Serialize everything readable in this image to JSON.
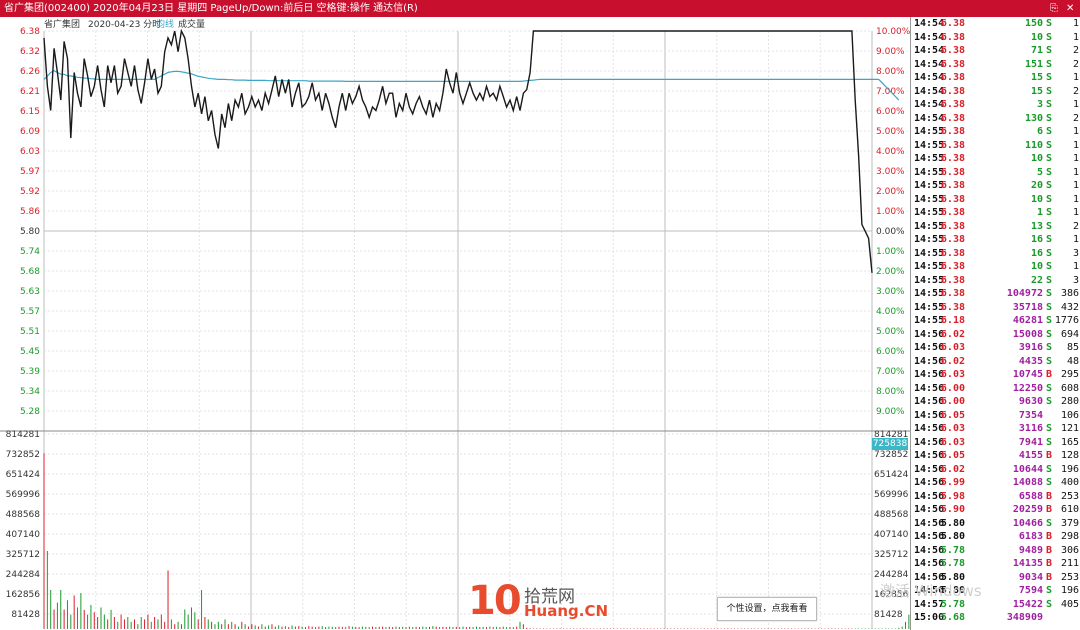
{
  "window": {
    "title": "省广集团(002400)  2020年04月23日  星期四  PageUp/Down:前后日  空格键:操作  通达信(R)",
    "controls": [
      "⎘",
      "✕"
    ]
  },
  "chart_header": {
    "name": "省广集团",
    "date": "2020-04-23 分时",
    "avg_label": "均线",
    "vol_label": "成交量"
  },
  "colors": {
    "up": "#d8202a",
    "down": "#1a9a2a",
    "price_line": "#1a1a1a",
    "avg_line": "#3ba6c9",
    "grid": "#e3e3e3",
    "grid_major": "#bcbcbc",
    "purple": "#a020a0",
    "titlebar": "#c8102e"
  },
  "price_axis": {
    "left_ticks": [
      "6.38",
      "6.32",
      "6.26",
      "6.21",
      "6.15",
      "6.09",
      "6.03",
      "5.97",
      "5.92",
      "5.86",
      "5.80",
      "5.74",
      "5.68",
      "5.63",
      "5.57",
      "5.51",
      "5.45",
      "5.39",
      "5.34",
      "5.28"
    ],
    "right_ticks": [
      "10.00%",
      "9.00%",
      "8.00%",
      "7.00%",
      "6.00%",
      "5.00%",
      "4.00%",
      "3.00%",
      "2.00%",
      "1.00%",
      "0.00%",
      "1.00%",
      "2.00%",
      "3.00%",
      "4.00%",
      "5.00%",
      "6.00%",
      "7.00%",
      "8.00%",
      "9.00%"
    ],
    "prev_close": 5.8,
    "high": 6.38,
    "low": 5.28
  },
  "volume_axis": {
    "ticks": [
      "814281",
      "732852",
      "651424",
      "569996",
      "488568",
      "407140",
      "325712",
      "244284",
      "162856",
      "81428"
    ],
    "max": 814281,
    "current_label": "725838"
  },
  "chart_data": {
    "type": "line",
    "title": "省广集团 2020-04-23 分时",
    "xlabel": "",
    "ylabel": "",
    "ylim": [
      5.28,
      6.38
    ],
    "series": [
      {
        "name": "分时",
        "x_note": "",
        "values": [
          6.36,
          6.22,
          6.15,
          6.33,
          6.26,
          6.18,
          6.35,
          6.3,
          6.07,
          6.26,
          6.2,
          6.16,
          6.3,
          6.25,
          6.19,
          6.22,
          6.28,
          6.21,
          6.16,
          6.28,
          6.23,
          6.28,
          6.2,
          6.22,
          6.3,
          6.26,
          6.22,
          6.28,
          6.21,
          6.17,
          6.23,
          6.3,
          6.24,
          6.27,
          6.2,
          6.22,
          6.32,
          6.36,
          6.34,
          6.38,
          6.32,
          6.38,
          6.36,
          6.3,
          6.22,
          6.16,
          6.2,
          6.14,
          6.19,
          6.12,
          6.15,
          6.08,
          6.04,
          6.14,
          6.1,
          6.17,
          6.12,
          6.18,
          6.16,
          6.2,
          6.14,
          6.16,
          6.19,
          6.16,
          6.18,
          6.15,
          6.2,
          6.17,
          6.21,
          6.25,
          6.19,
          6.24,
          6.2,
          6.24,
          6.16,
          6.2,
          6.23,
          6.16,
          6.17,
          6.19,
          6.23,
          6.18,
          6.2,
          6.15,
          6.2,
          6.17,
          6.13,
          6.1,
          6.16,
          6.2,
          6.15,
          6.2,
          6.17,
          6.19,
          6.22,
          6.18,
          6.16,
          6.13,
          6.16,
          6.15,
          6.18,
          6.22,
          6.17,
          6.2,
          6.2,
          6.13,
          6.17,
          6.15,
          6.2,
          6.16,
          6.14,
          6.17,
          6.19,
          6.16,
          6.14,
          6.18,
          6.13,
          6.17,
          6.15,
          6.2,
          6.27,
          6.23,
          6.2,
          6.26,
          6.2,
          6.17,
          6.2,
          6.23,
          6.2,
          6.18,
          6.2,
          6.18,
          6.22,
          6.19,
          6.2,
          6.18,
          6.22,
          6.19,
          6.16,
          6.18,
          6.15,
          6.19,
          6.15,
          6.2,
          6.21,
          6.26,
          6.38,
          6.38,
          6.38,
          6.38,
          6.38,
          6.38,
          6.38,
          6.38,
          6.38,
          6.38,
          6.38,
          6.38,
          6.38,
          6.38,
          6.38,
          6.38,
          6.38,
          6.38,
          6.38,
          6.38,
          6.38,
          6.38,
          6.38,
          6.38,
          6.38,
          6.38,
          6.38,
          6.38,
          6.38,
          6.38,
          6.38,
          6.38,
          6.38,
          6.38,
          6.38,
          6.38,
          6.38,
          6.38,
          6.38,
          6.38,
          6.38,
          6.38,
          6.38,
          6.38,
          6.38,
          6.38,
          6.38,
          6.38,
          6.38,
          6.38,
          6.38,
          6.38,
          6.38,
          6.38,
          6.38,
          6.38,
          6.38,
          6.38,
          6.38,
          6.38,
          6.38,
          6.38,
          6.38,
          6.38,
          6.38,
          6.38,
          6.38,
          6.38,
          6.38,
          6.38,
          6.38,
          6.38,
          6.38,
          6.38,
          6.38,
          6.38,
          6.38,
          6.38,
          6.38,
          6.38,
          6.38,
          6.38,
          6.38,
          6.38,
          6.38,
          6.38,
          6.38,
          6.38,
          6.38,
          6.38,
          6.38,
          6.38,
          6.38,
          6.38,
          6.38,
          6.38,
          6.18,
          6.02,
          5.82,
          5.8,
          5.78,
          5.68
        ]
      },
      {
        "name": "均线",
        "values": [
          6.24,
          6.25,
          6.26,
          6.265,
          6.26,
          6.255,
          6.255,
          6.25,
          6.25,
          6.248,
          6.246,
          6.245,
          6.244,
          6.243,
          6.242,
          6.241,
          6.24,
          6.24,
          6.24,
          6.24,
          6.24,
          6.24,
          6.24,
          6.24,
          6.24,
          6.24,
          6.24,
          6.24,
          6.24,
          6.24,
          6.24,
          6.24,
          6.24,
          6.24,
          6.245,
          6.25,
          6.255,
          6.26,
          6.262,
          6.263,
          6.263,
          6.262,
          6.26,
          6.258,
          6.256,
          6.252,
          6.249,
          6.247,
          6.245,
          6.243,
          6.242,
          6.241,
          6.24,
          6.24,
          6.24,
          6.239,
          6.239,
          6.238,
          6.238,
          6.238,
          6.238,
          6.237,
          6.237,
          6.237,
          6.237,
          6.237,
          6.237,
          6.236,
          6.236,
          6.236,
          6.236,
          6.236,
          6.236,
          6.236,
          6.236,
          6.236,
          6.236,
          6.236,
          6.236,
          6.235,
          6.235,
          6.235,
          6.235,
          6.235,
          6.235,
          6.235,
          6.235,
          6.235,
          6.235,
          6.235,
          6.234,
          6.234,
          6.234,
          6.234,
          6.234,
          6.234,
          6.234,
          6.234,
          6.234,
          6.234,
          6.234,
          6.234,
          6.234,
          6.234,
          6.234,
          6.234,
          6.234,
          6.234,
          6.234,
          6.234,
          6.234,
          6.234,
          6.234,
          6.234,
          6.234,
          6.234,
          6.234,
          6.234,
          6.234,
          6.234,
          6.234,
          6.234,
          6.234,
          6.234,
          6.234,
          6.234,
          6.234,
          6.234,
          6.234,
          6.234,
          6.234,
          6.234,
          6.234,
          6.234,
          6.234,
          6.234,
          6.234,
          6.234,
          6.234,
          6.234,
          6.234,
          6.234,
          6.234,
          6.235,
          6.236,
          6.237,
          6.238,
          6.239,
          6.24,
          6.24,
          6.24,
          6.24,
          6.24,
          6.24,
          6.24,
          6.24,
          6.24,
          6.24,
          6.24,
          6.24,
          6.24,
          6.24,
          6.24,
          6.24,
          6.24,
          6.24,
          6.24,
          6.24,
          6.24,
          6.24,
          6.24,
          6.24,
          6.24,
          6.24,
          6.24,
          6.24,
          6.24,
          6.24,
          6.24,
          6.24,
          6.24,
          6.24,
          6.24,
          6.24,
          6.24,
          6.24,
          6.24,
          6.24,
          6.24,
          6.24,
          6.24,
          6.24,
          6.24,
          6.24,
          6.24,
          6.24,
          6.24,
          6.24,
          6.24,
          6.24,
          6.24,
          6.24,
          6.24,
          6.24,
          6.24,
          6.24,
          6.24,
          6.24,
          6.24,
          6.24,
          6.24,
          6.24,
          6.24,
          6.24,
          6.24,
          6.24,
          6.24,
          6.24,
          6.24,
          6.24,
          6.24,
          6.24,
          6.24,
          6.24,
          6.24,
          6.24,
          6.24,
          6.24,
          6.24,
          6.24,
          6.24,
          6.24,
          6.24,
          6.24,
          6.24,
          6.24,
          6.24,
          6.24,
          6.24,
          6.24,
          6.24,
          6.24,
          6.24,
          6.24,
          6.24,
          6.24,
          6.24,
          6.24,
          6.24,
          6.24,
          6.23,
          6.22,
          6.21,
          6.2,
          6.19,
          6.18
        ]
      }
    ],
    "volume": [
      732852,
      325712,
      162856,
      81428,
      110000,
      162856,
      81428,
      120000,
      60000,
      140000,
      90000,
      150000,
      80000,
      60000,
      100000,
      70000,
      50000,
      90000,
      60000,
      40000,
      80000,
      50000,
      30000,
      60000,
      40000,
      50000,
      30000,
      40000,
      20000,
      50000,
      40000,
      60000,
      30000,
      50000,
      40000,
      60000,
      30000,
      244284,
      40000,
      20000,
      30000,
      20000,
      81428,
      60000,
      90000,
      70000,
      40000,
      162856,
      50000,
      40000,
      30000,
      20000,
      30000,
      20000,
      40000,
      20000,
      30000,
      20000,
      10000,
      30000,
      20000,
      10000,
      20000,
      15000,
      10000,
      20000,
      10000,
      15000,
      20000,
      10000,
      15000,
      10000,
      12000,
      8000,
      15000,
      10000,
      12000,
      10000,
      8000,
      12000,
      10000,
      8000,
      10000,
      12000,
      8000,
      10000,
      9000,
      8000,
      10000,
      9000,
      8000,
      12000,
      10000,
      9000,
      8000,
      10000,
      9000,
      8000,
      10000,
      8000,
      9000,
      10000,
      8000,
      9000,
      8000,
      10000,
      8000,
      9000,
      8000,
      10000,
      8000,
      9000,
      8000,
      10000,
      8000,
      9000,
      12000,
      10000,
      8000,
      9000,
      8000,
      10000,
      8000,
      9000,
      8000,
      10000,
      8000,
      9000,
      8000,
      10000,
      8000,
      9000,
      8000,
      10000,
      8000,
      9000,
      8000,
      10000,
      8000,
      9000,
      8000,
      10000,
      30000,
      20000,
      5000,
      3000,
      2000,
      2000,
      2000,
      2000,
      2000,
      2000,
      2000,
      2000,
      2000,
      2000,
      2000,
      2000,
      2000,
      2000,
      2000,
      2000,
      2000,
      2000,
      2000,
      2000,
      2000,
      2000,
      2000,
      2000,
      2000,
      2000,
      2000,
      2000,
      2000,
      2000,
      2000,
      2000,
      2000,
      2000,
      2000,
      2000,
      2000,
      2000,
      2000,
      2000,
      2000,
      2000,
      2000,
      2000,
      2000,
      2000,
      2000,
      2000,
      2000,
      2000,
      2000,
      2000,
      2000,
      2000,
      2000,
      2000,
      2000,
      2000,
      2000,
      2000,
      2000,
      2000,
      2000,
      2000,
      2000,
      2000,
      2000,
      2000,
      2000,
      2000,
      2000,
      2000,
      2000,
      2000,
      2000,
      2000,
      2000,
      2000,
      2000,
      2000,
      2000,
      2000,
      2000,
      2000,
      2000,
      2000,
      2000,
      2000,
      2000,
      2000,
      2000,
      2000,
      2000,
      2000,
      2000,
      2000,
      2000,
      2000,
      2000,
      2000,
      2000,
      2000,
      2000,
      2000,
      2000,
      2000,
      2000,
      2000,
      2000,
      5000,
      10000,
      30000,
      60000,
      200000,
      240000,
      244284
    ]
  },
  "ticks": [
    [
      "14:54",
      "6.38",
      "150",
      "S",
      "1"
    ],
    [
      "14:54",
      "6.38",
      "10",
      "S",
      "1"
    ],
    [
      "14:54",
      "6.38",
      "71",
      "S",
      "2"
    ],
    [
      "14:54",
      "6.38",
      "151",
      "S",
      "2"
    ],
    [
      "14:54",
      "6.38",
      "15",
      "S",
      "1"
    ],
    [
      "14:54",
      "6.38",
      "15",
      "S",
      "2"
    ],
    [
      "14:54",
      "6.38",
      "3",
      "S",
      "1"
    ],
    [
      "14:54",
      "6.38",
      "130",
      "S",
      "2"
    ],
    [
      "14:55",
      "6.38",
      "6",
      "S",
      "1"
    ],
    [
      "14:55",
      "6.38",
      "110",
      "S",
      "1"
    ],
    [
      "14:55",
      "6.38",
      "10",
      "S",
      "1"
    ],
    [
      "14:55",
      "6.38",
      "5",
      "S",
      "1"
    ],
    [
      "14:55",
      "6.38",
      "20",
      "S",
      "1"
    ],
    [
      "14:55",
      "6.38",
      "10",
      "S",
      "1"
    ],
    [
      "14:55",
      "6.38",
      "1",
      "S",
      "1"
    ],
    [
      "14:55",
      "6.38",
      "13",
      "S",
      "2"
    ],
    [
      "14:55",
      "6.38",
      "16",
      "S",
      "1"
    ],
    [
      "14:55",
      "6.38",
      "16",
      "S",
      "3"
    ],
    [
      "14:55",
      "6.38",
      "10",
      "S",
      "1"
    ],
    [
      "14:55",
      "6.38",
      "22",
      "S",
      "3"
    ],
    [
      "14:55",
      "6.38",
      "104972",
      "S",
      "386"
    ],
    [
      "14:55",
      "6.38",
      "35718",
      "S",
      "432"
    ],
    [
      "14:55",
      "6.18",
      "46281",
      "S",
      "1776"
    ],
    [
      "14:56",
      "6.02",
      "15008",
      "S",
      "694"
    ],
    [
      "14:56",
      "6.03",
      "3916",
      "S",
      "85"
    ],
    [
      "14:56",
      "6.02",
      "4435",
      "S",
      "48"
    ],
    [
      "14:56",
      "6.03",
      "10745",
      "B",
      "295"
    ],
    [
      "14:56",
      "6.00",
      "12250",
      "S",
      "608"
    ],
    [
      "14:56",
      "6.00",
      "9630",
      "S",
      "280"
    ],
    [
      "14:56",
      "6.05",
      "7354",
      "",
      "106"
    ],
    [
      "14:56",
      "6.03",
      "3116",
      "S",
      "121"
    ],
    [
      "14:56",
      "6.03",
      "7941",
      "S",
      "165"
    ],
    [
      "14:56",
      "6.05",
      "4155",
      "B",
      "128"
    ],
    [
      "14:56",
      "6.02",
      "10644",
      "S",
      "196"
    ],
    [
      "14:56",
      "5.99",
      "14088",
      "S",
      "400"
    ],
    [
      "14:56",
      "5.98",
      "6588",
      "B",
      "253"
    ],
    [
      "14:56",
      "5.90",
      "20259",
      "B",
      "610"
    ],
    [
      "14:56",
      "5.80",
      "10466",
      "S",
      "379"
    ],
    [
      "14:56",
      "5.80",
      "6183",
      "B",
      "298"
    ],
    [
      "14:56",
      "5.78",
      "9489",
      "B",
      "306"
    ],
    [
      "14:56",
      "5.78",
      "14135",
      "B",
      "211"
    ],
    [
      "14:56",
      "5.80",
      "9034",
      "B",
      "253"
    ],
    [
      "14:56",
      "5.80",
      "7594",
      "S",
      "196"
    ],
    [
      "14:57",
      "5.78",
      "15422",
      "S",
      "405"
    ],
    [
      "15:00",
      "5.68",
      "348909",
      "",
      ""
    ]
  ],
  "tooltip": "个性设置，点我看看",
  "watermark": {
    "num": "10",
    "cn": "拾荒网",
    "en": "Huang.CN"
  },
  "ghost_text": "激活 Windows"
}
